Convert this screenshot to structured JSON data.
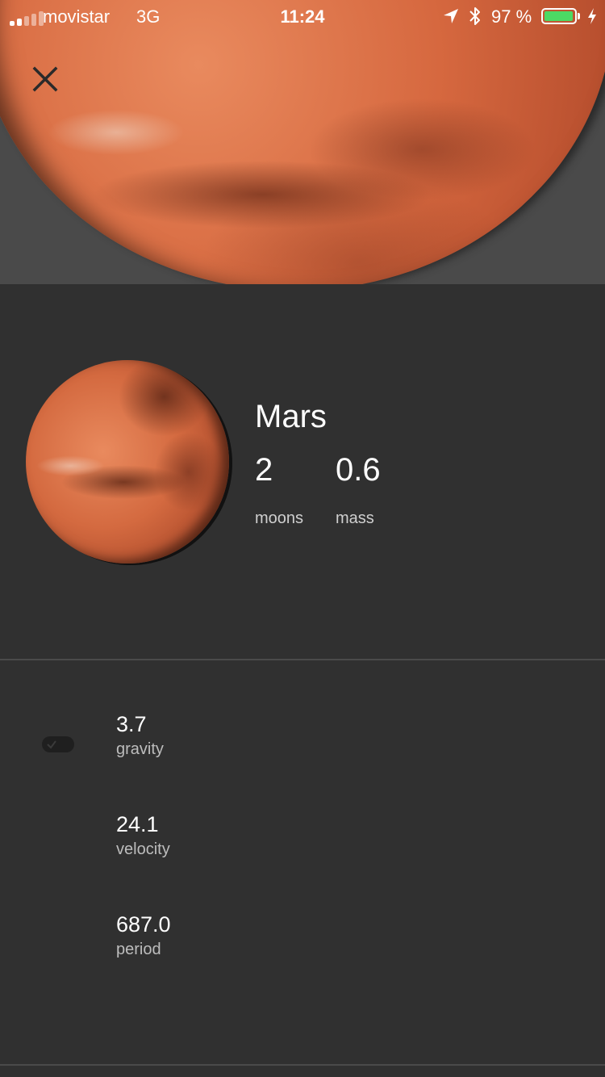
{
  "status_bar": {
    "carrier": "movistar",
    "network": "3G",
    "time": "11:24",
    "battery_percent": "97 %",
    "battery_level": 0.97,
    "battery_color": "#4cd964",
    "icons": [
      "signal-icon",
      "location-arrow-icon",
      "bluetooth-icon",
      "battery-icon",
      "charging-bolt-icon"
    ]
  },
  "hero": {
    "close_icon": "close-icon"
  },
  "planet": {
    "name": "Mars",
    "moons_value": "2",
    "moons_label": "moons",
    "mass_value": "0.6",
    "mass_label": "mass",
    "accent_color": "#d46a40"
  },
  "details": {
    "toggle_icon": "check-icon",
    "items": [
      {
        "value": "3.7",
        "label": "gravity"
      },
      {
        "value": "24.1",
        "label": "velocity"
      },
      {
        "value": "687.0",
        "label": "period"
      }
    ]
  },
  "theme": {
    "background": "#303030",
    "text": "#ffffff",
    "muted_text": "#bdbdbd"
  }
}
